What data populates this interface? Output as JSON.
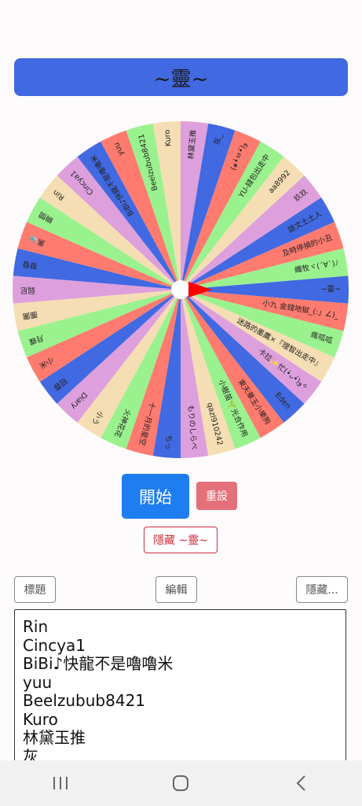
{
  "title": "~靈~",
  "buttons": {
    "start": "開始",
    "reset": "重設",
    "hide_result": "隱藏 ~靈~",
    "title_btn": "標題",
    "edit_btn": "編輯",
    "hide_btn": "隱藏..."
  },
  "colors": {
    "slices": [
      "#4169e1",
      "#ff7b6f",
      "#9af28e",
      "#f5deb3",
      "#dda0dd"
    ],
    "pointer": "#ff0000",
    "start_button": "#1e7df0",
    "reset_button": "#e4707a"
  },
  "wheel_entries": [
    "~靈~",
    "小九 金錢地獄_(:」∠)_",
    "瘋呱呱",
    "迷路的墨鷹×『理智出走中』",
    "卡拉✨忙(•̀ᴗ•́)و✧",
    "Eden",
    "東天華玉小樂狗",
    "小樹苗🌱光合作用",
    "qazl910242",
    "もりのしらべ",
    "ちっ",
    "十一月的星空",
    "火神花花",
    "小う",
    "Diary",
    "冠蓉",
    "小米",
    "月蝶",
    "團團",
    "弱尼",
    "發發",
    "黑🐳",
    "瞬間",
    "Rin",
    "Cincya1",
    "BiBi♪快龍不是嚕嚕米",
    "yuu",
    "Beelzubub8421",
    "Kuro",
    "林黛玉推",
    "灰_",
    "(๑•̀ㅂ•́)و",
    "YU-錢包出走中",
    "aa8992",
    "玖玖",
    "語文土土人",
    "及時停損的小丑",
    "纖牧ヾ(´∀`)ﾉ"
  ],
  "list_lines": [
    "Rin",
    "Cincya1",
    "BiBi♪快龍不是嚕嚕米",
    "yuu",
    "Beelzubub8421",
    "Kuro",
    "林黛玉推",
    "灰_"
  ]
}
